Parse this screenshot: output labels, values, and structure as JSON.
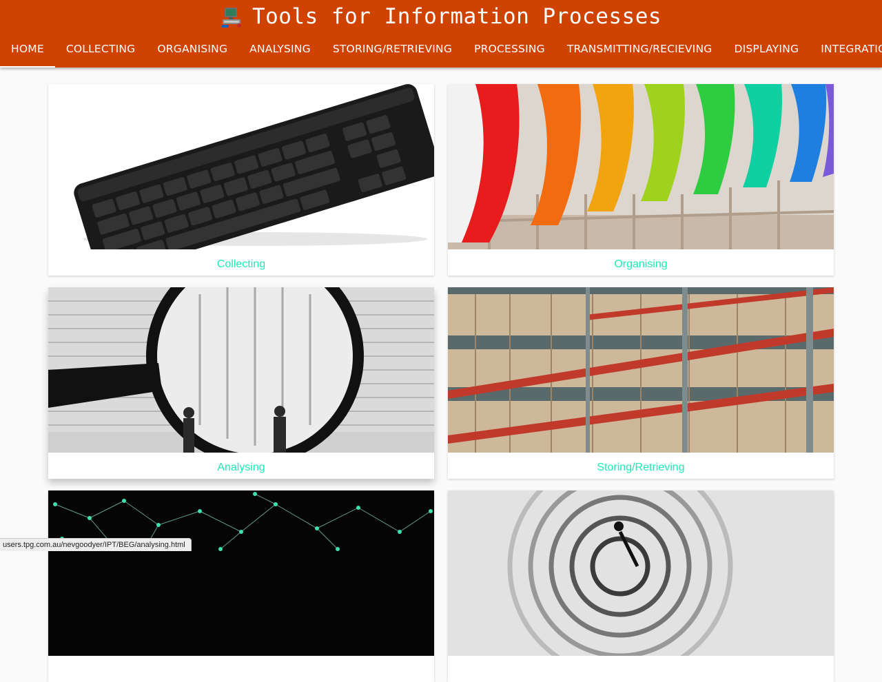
{
  "header": {
    "title": "Tools for Information Processes",
    "logo_icon": "computer-icon",
    "background_color": "#cf4200"
  },
  "nav": {
    "tabs": [
      {
        "label": "HOME",
        "active": true
      },
      {
        "label": "COLLECTING"
      },
      {
        "label": "ORGANISING"
      },
      {
        "label": "ANALYSING"
      },
      {
        "label": "STORING/RETRIEVING"
      },
      {
        "label": "PROCESSING"
      },
      {
        "label": "TRANSMITTING/RECIEVING"
      },
      {
        "label": "DISPLAYING"
      },
      {
        "label": "INTEGRATIO"
      }
    ]
  },
  "cards": [
    {
      "label": "Collecting",
      "image": "keyboard-image"
    },
    {
      "label": "Organising",
      "image": "colored-folders-image"
    },
    {
      "label": "Analysing",
      "image": "magnifying-glass-image"
    },
    {
      "label": "Storing/Retrieving",
      "image": "warehouse-shelves-image"
    },
    {
      "label": "",
      "image": "network-graph-image"
    },
    {
      "label": "",
      "image": "spiral-image"
    }
  ],
  "accent_color": "#1de9b6",
  "status_bar": {
    "url": "users.tpg.com.au/nevgoodyer/IPT/BEG/analysing.html"
  }
}
